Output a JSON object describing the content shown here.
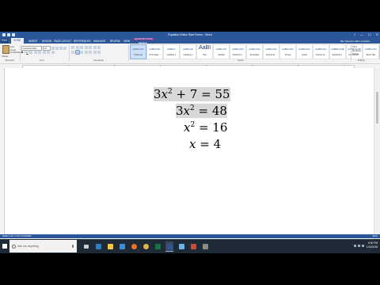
{
  "window": {
    "title": "Equation Editor Start Demo - Word",
    "controls": [
      "?",
      "—",
      "☐",
      "✕"
    ]
  },
  "tabs": [
    "FILE",
    "HOME",
    "INSERT",
    "DESIGN",
    "PAGE LAYOUT",
    "REFERENCES",
    "MAILINGS",
    "REVIEW",
    "VIEW",
    "DESIGN"
  ],
  "equation_tools_label": "EQUATION TOOLS",
  "user": "Ben Morrison (Ben Cusack) ...",
  "clipboard": {
    "paste_label": "Paste",
    "cut": "Cut",
    "copy": "Copy",
    "format_painter": "Format Painter",
    "group": "Clipboard"
  },
  "font": {
    "name": "Cambria Math",
    "size": "16",
    "group": "Font"
  },
  "paragraph_group": "Paragraph",
  "styles_group": "Styles",
  "styles": [
    {
      "preview": "AaBbCcDc",
      "name": "¶ Normal"
    },
    {
      "preview": "AaBbCcDc",
      "name": "¶ No Spac..."
    },
    {
      "preview": "AaBbCc",
      "name": "Heading 1"
    },
    {
      "preview": "AaBbCcE",
      "name": "Heading 2"
    },
    {
      "preview": "AaBl",
      "name": "Title"
    },
    {
      "preview": "AaBbCcD",
      "name": "Subtitle"
    },
    {
      "preview": "AaBbCcDu",
      "name": "Subtle Em..."
    },
    {
      "preview": "AaBbCcDu",
      "name": "Emphasis"
    },
    {
      "preview": "AaBbCcDu",
      "name": "Intense E..."
    },
    {
      "preview": "AaBbCcDu",
      "name": "Strong"
    },
    {
      "preview": "AaBbCcDc",
      "name": "Quote"
    },
    {
      "preview": "AaBbCcDc",
      "name": "Intense Q..."
    },
    {
      "preview": "AABBCCDE",
      "name": "Subtle Ref..."
    },
    {
      "preview": "AABBCCDE",
      "name": "Intense Re..."
    },
    {
      "preview": "AaBbCcDe",
      "name": "Book Title"
    }
  ],
  "editing": {
    "find": "Find",
    "replace": "Replace",
    "select": "Select",
    "group": "Editing"
  },
  "equations": [
    {
      "lhs": "3x",
      "exp": "2",
      "rest": " + 7 = 55"
    },
    {
      "lhs": "3x",
      "exp": "2",
      "rest": " = 48"
    },
    {
      "lhs": "x",
      "exp": "2",
      "rest": " = 16"
    },
    {
      "lhs": "x",
      "exp": "",
      "rest": " = 4"
    }
  ],
  "ruler_ticks": [
    "1",
    "2",
    "3",
    "4",
    "5",
    "6",
    "7"
  ],
  "status": {
    "left": "PAGE 1 OF 1   7 OF 14 WORDS",
    "right": "100%"
  },
  "taskbar": {
    "search_placeholder": "Ask me anything",
    "time": "6:00 PM",
    "date": "1/14/2016"
  }
}
